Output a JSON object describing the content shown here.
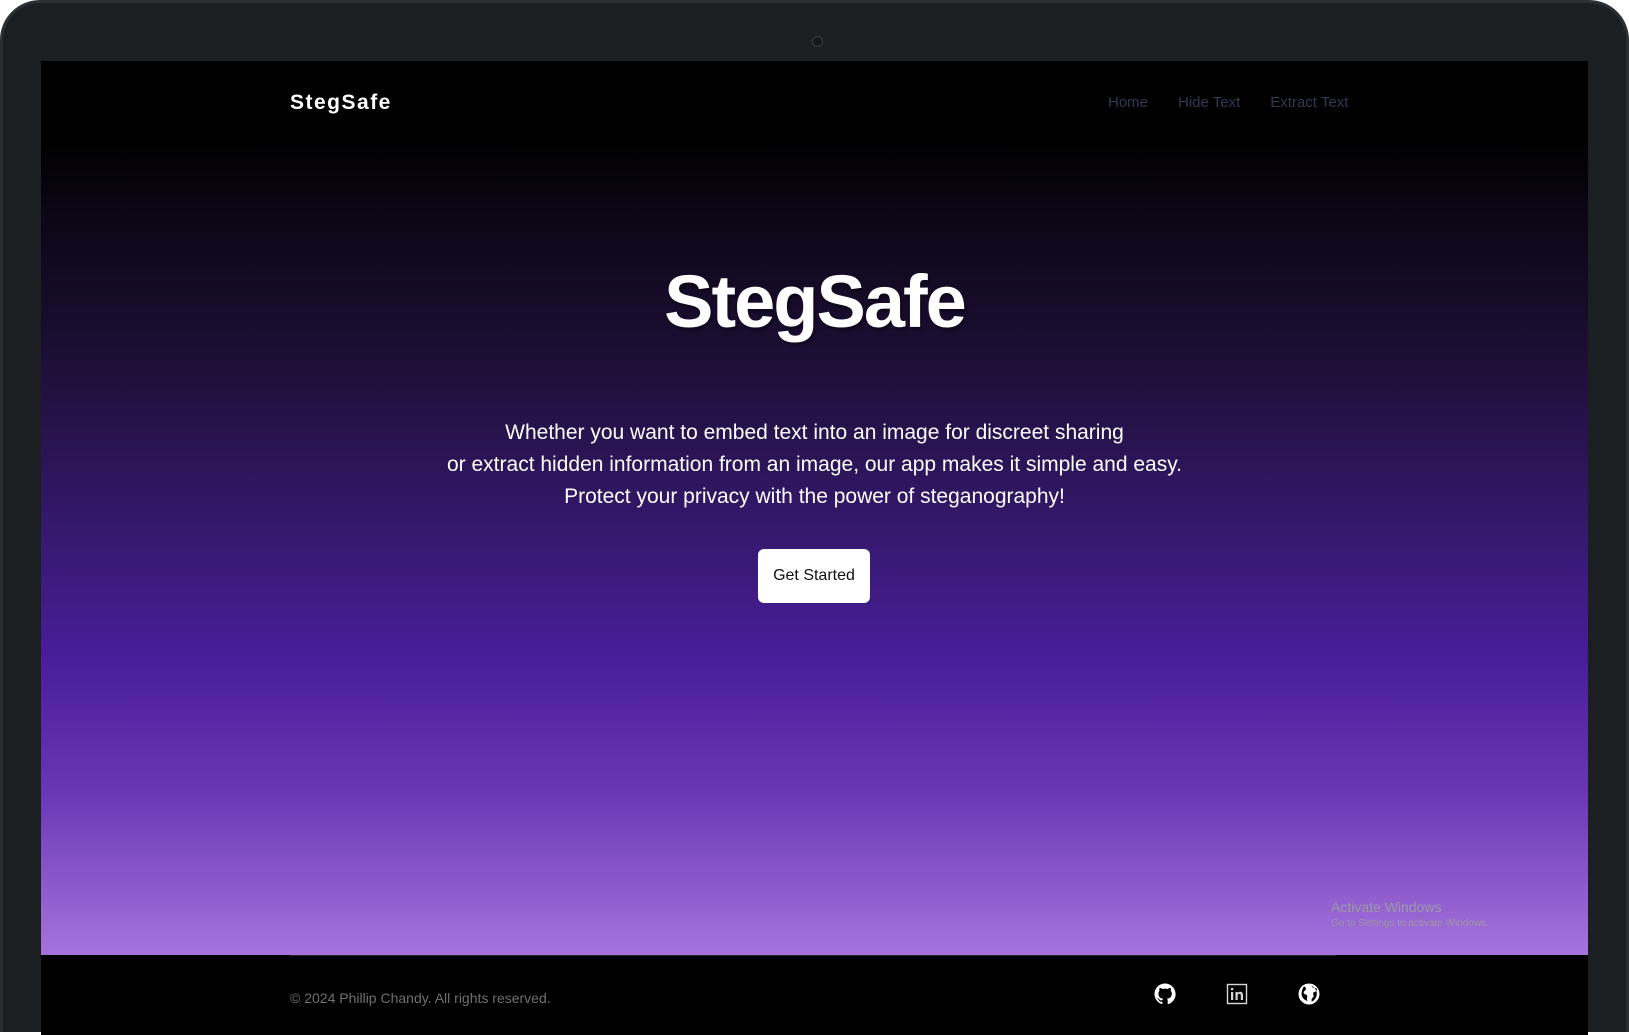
{
  "header": {
    "brand": "StegSafe",
    "nav": [
      "Home",
      "Hide Text",
      "Extract Text"
    ]
  },
  "hero": {
    "title": "StegSafe",
    "tagline": [
      "Whether you want to embed text into an image for discreet sharing",
      "or extract hidden information from an image, our app makes it simple and easy.",
      "Protect your privacy with the power of steganography!"
    ],
    "cta_label": "Get Started"
  },
  "footer": {
    "copyright": "© 2024 Phillip Chandy. All rights reserved.",
    "social_icons": [
      "github-icon",
      "linkedin-icon",
      "globe-icon"
    ]
  },
  "os_overlay": {
    "title": "Activate Windows",
    "subtitle": "Go to Settings to activate Windows."
  },
  "colors": {
    "gradient_top": "#000000",
    "gradient_mid": "#4a1d9a",
    "gradient_bottom": "#a673de",
    "nav_link": "#2e3b52",
    "button_bg": "#ffffff"
  }
}
